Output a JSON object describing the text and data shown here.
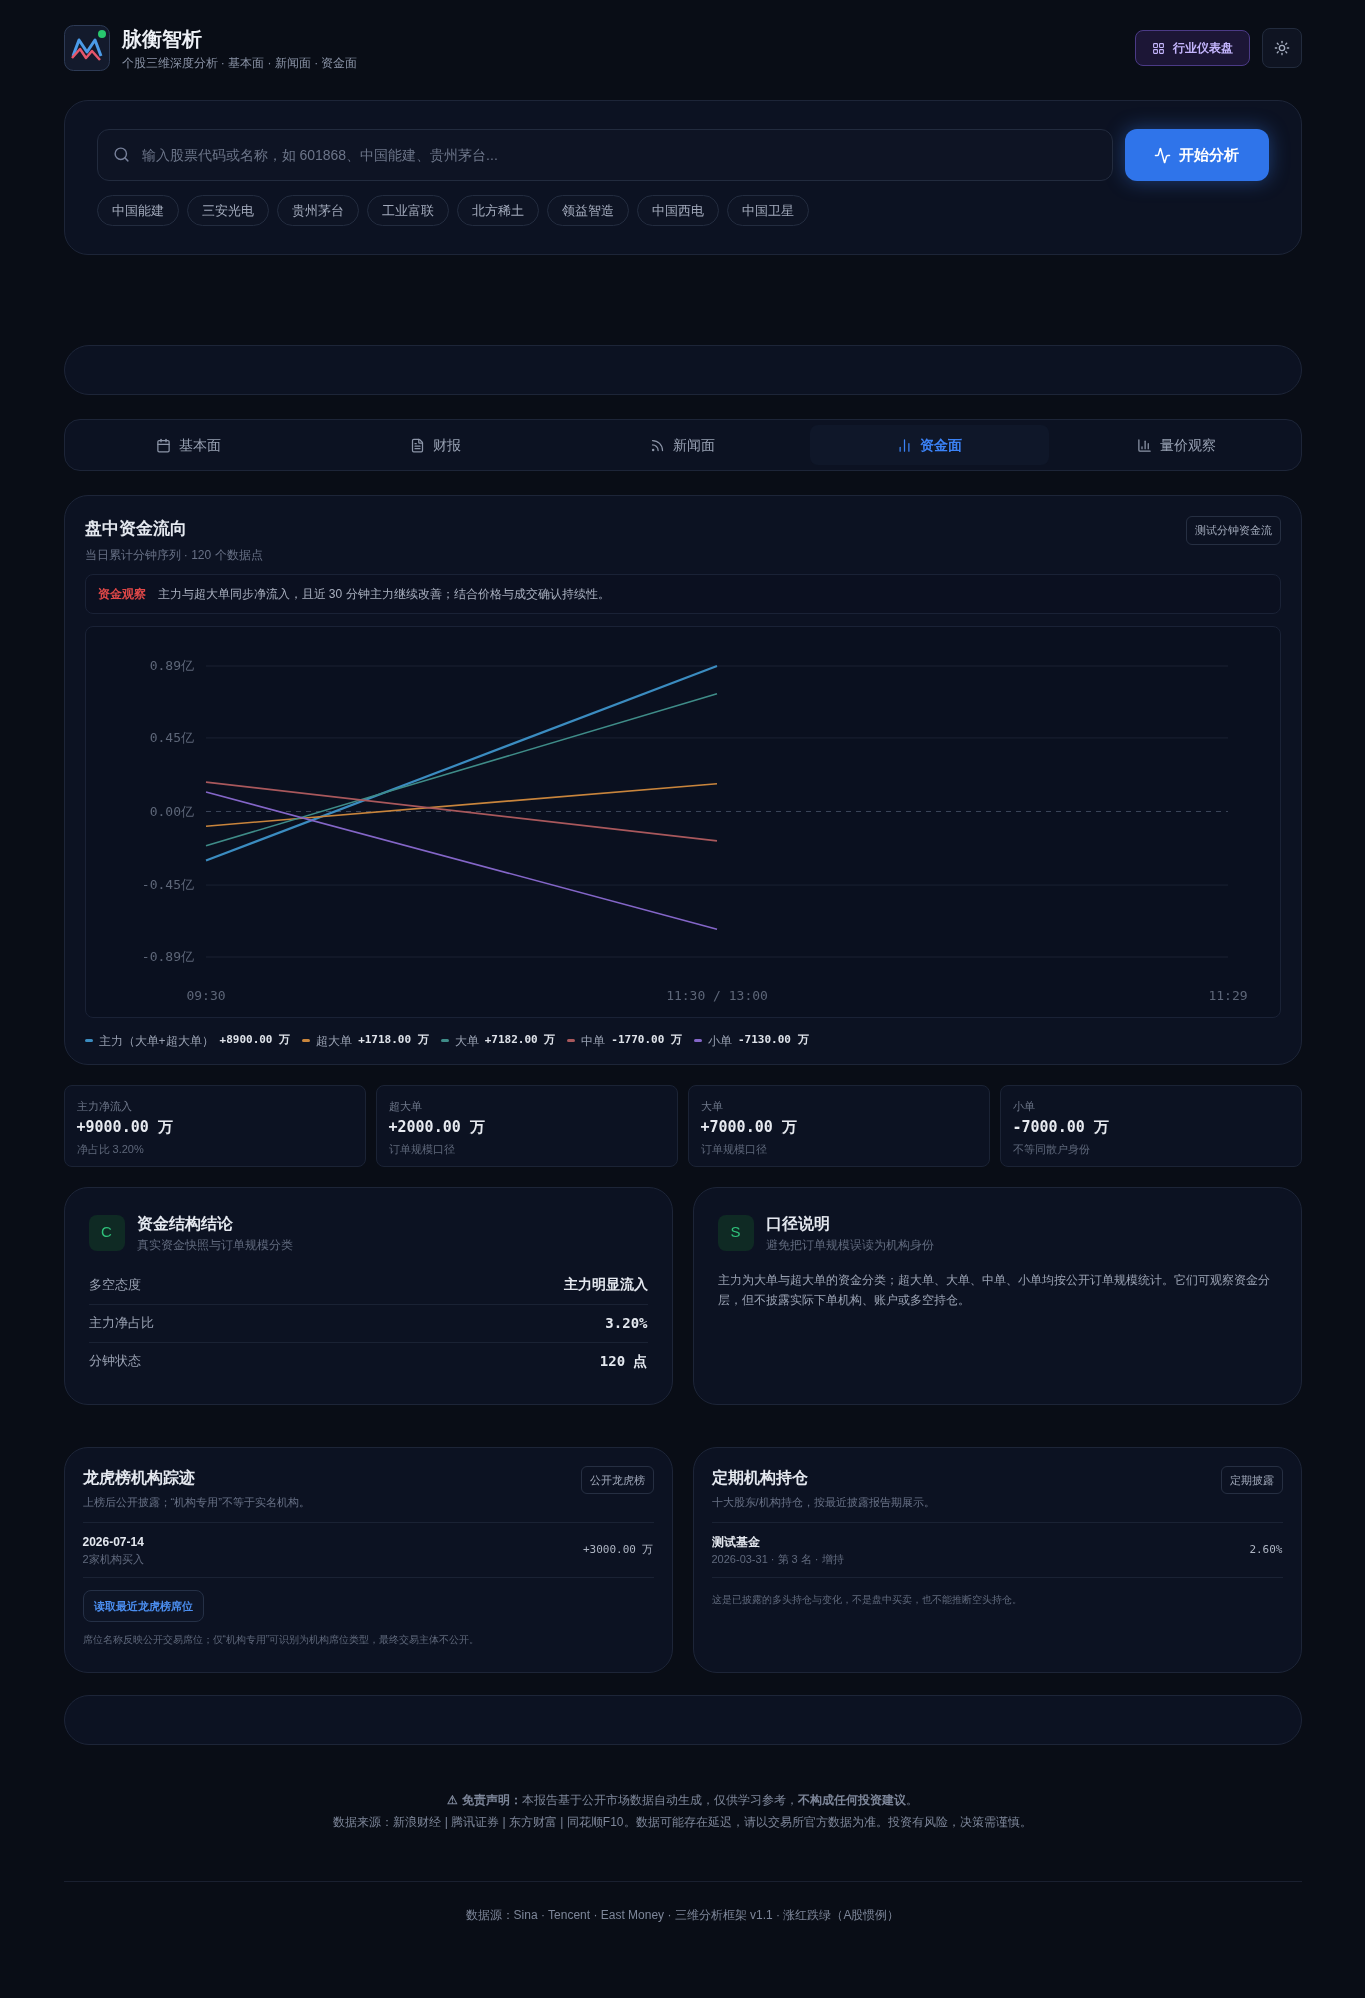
{
  "header": {
    "title": "脉衡智析",
    "subtitle": "个股三维深度分析 · 基本面 · 新闻面 · 资金面",
    "dashboard_button": "行业仪表盘"
  },
  "search": {
    "placeholder": "输入股票代码或名称，如 601868、中国能建、贵州茅台...",
    "button": "开始分析",
    "chips": [
      "中国能建",
      "三安光电",
      "贵州茅台",
      "工业富联",
      "北方稀土",
      "领益智造",
      "中国西电",
      "中国卫星"
    ]
  },
  "tabs": [
    {
      "label": "基本面",
      "kind": "calendar",
      "selected": false
    },
    {
      "label": "财报",
      "kind": "document",
      "selected": false
    },
    {
      "label": "新闻面",
      "kind": "rss",
      "selected": false
    },
    {
      "label": "资金面",
      "kind": "bars",
      "selected": true
    },
    {
      "label": "量价观察",
      "kind": "chart",
      "selected": false
    }
  ],
  "flow_card": {
    "title": "盘中资金流向",
    "subtitle": "当日累计分钟序列 · 120 个数据点",
    "badge": "测试分钟资金流",
    "insight_label": "资金观察",
    "insight": "主力与超大单同步净流入，且近 30 分钟主力继续改善；结合价格与成交确认持续性。",
    "chart_data": {
      "type": "line",
      "ref_lines": [
        {
          "axis": "y",
          "value": 0
        }
      ],
      "categories": [
        "09:30",
        "11:30 / 13:00",
        "11:29"
      ],
      "ylim": [
        -0.89,
        0.89
      ],
      "yticks": [
        {
          "value": 0.89,
          "label": "0.89亿"
        },
        {
          "value": 0.45,
          "label": "0.45亿"
        },
        {
          "value": 0,
          "label": "0.00亿"
        },
        {
          "value": -0.45,
          "label": "-0.45亿"
        },
        {
          "value": -0.89,
          "label": "-0.89亿"
        }
      ],
      "series": [
        {
          "name": "主力（大单+超大单）",
          "color": "#3b8cc0",
          "values": [
            -0.3,
            0.89,
            null
          ]
        },
        {
          "name": "超大单",
          "color": "#c9853c",
          "values": [
            -0.09,
            0.17,
            null
          ]
        },
        {
          "name": "大单",
          "color": "#3f8c88",
          "values": [
            -0.21,
            0.72,
            null
          ]
        },
        {
          "name": "中单",
          "color": "#a9585c",
          "values": [
            0.18,
            -0.18,
            null
          ]
        },
        {
          "name": "小单",
          "color": "#8466c8",
          "values": [
            0.12,
            -0.72,
            null
          ]
        }
      ]
    },
    "legend": [
      {
        "value": "+8900.00 万"
      },
      {
        "value": "+1718.00 万"
      },
      {
        "value": "+7182.00 万"
      },
      {
        "value": "-1770.00 万"
      },
      {
        "value": "-7130.00 万"
      }
    ]
  },
  "stats": [
    {
      "label": "主力净流入",
      "value": "+9000.00 万",
      "note": "净占比 3.20%"
    },
    {
      "label": "超大单",
      "value": "+2000.00 万",
      "note": "订单规模口径"
    },
    {
      "label": "大单",
      "value": "+7000.00 万",
      "note": "订单规模口径"
    },
    {
      "label": "小单",
      "value": "-7000.00 万",
      "note": "不等同散户身份"
    }
  ],
  "structure": {
    "letter": "C",
    "title": "资金结构结论",
    "subtitle": "真实资金快照与订单规模分类",
    "rows": [
      {
        "label": "多空态度",
        "value": "主力明显流入"
      },
      {
        "label": "主力净占比",
        "value": "3.20%"
      },
      {
        "label": "分钟状态",
        "value": "120 点"
      }
    ]
  },
  "explain": {
    "letter": "S",
    "title": "口径说明",
    "subtitle": "避免把订单规模误读为机构身份",
    "text": "主力为大单与超大单的资金分类；超大单、大单、中单、小单均按公开订单规模统计。它们可观察资金分层，但不披露实际下单机构、账户或多空持仓。"
  },
  "dragon": {
    "title": "龙虎榜机构踪迹",
    "subtitle": "上榜后公开披露；“机构专用”不等于实名机构。",
    "badge": "公开龙虎榜",
    "row": {
      "date": "2026-07-14",
      "note": "2家机构买入",
      "value": "+3000.00 万"
    },
    "button": "读取最近龙虎榜席位",
    "footnote": "席位名称反映公开交易席位；仅“机构专用”可识别为机构席位类型，最终交易主体不公开。"
  },
  "holdings": {
    "title": "定期机构持仓",
    "subtitle": "十大股东/机构持仓，按最近披露报告期展示。",
    "badge": "定期披露",
    "row": {
      "name": "测试基金",
      "note": "2026-03-31 · 第 3 名 · 增持",
      "value": "2.60%"
    },
    "footnote": "这是已披露的多头持仓与变化，不是盘中买卖，也不能推断空头持仓。"
  },
  "disclaimer": {
    "text": "**⚠ 免责声明：**本报告基于公开市场数据自动生成，仅供学习参考，**不构成任何投资建议**。",
    "sources": "数据来源：新浪财经 | 腾讯证券 | 东方财富 | 同花顺F10。数据可能存在延迟，请以交易所官方数据为准。投资有风险，决策需谨慎。"
  },
  "footer": "数据源：Sina · Tencent · East Money · 三维分析框架 v1.1 · 涨红跌绿（A股惯例）"
}
